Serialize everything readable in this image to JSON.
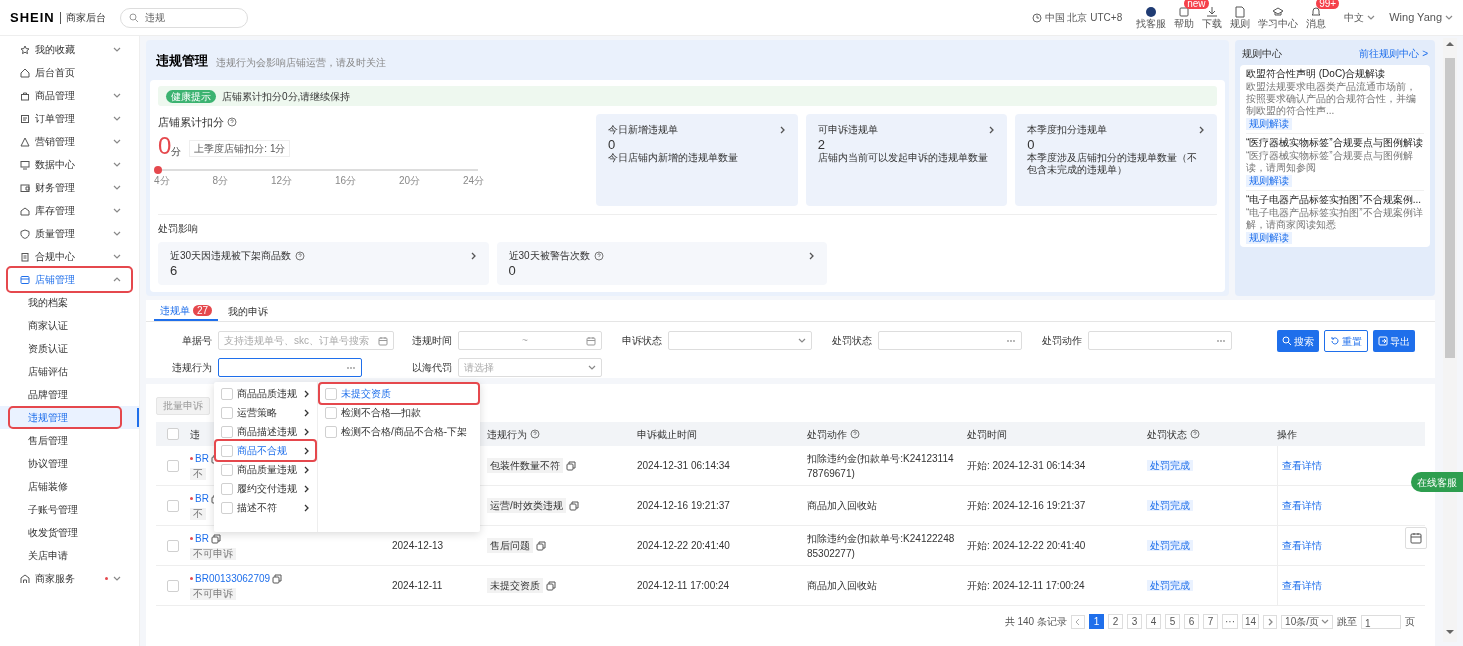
{
  "header": {
    "logo": "SHEIN",
    "subtitle": "商家后台",
    "search_value": "违规",
    "timezone": "中国 北京 UTC+8",
    "tools": [
      {
        "label": "找客服"
      },
      {
        "label": "帮助",
        "badge": "new"
      },
      {
        "label": "下载"
      },
      {
        "label": "规则"
      },
      {
        "label": "学习中心"
      },
      {
        "label": "消息",
        "badge": "99+"
      }
    ],
    "language": "中文",
    "user": "Wing Yang"
  },
  "sidebar": {
    "items": [
      {
        "label": "我的收藏",
        "kind": "group",
        "expanded": false,
        "selected": false,
        "annotated": false,
        "notification": false
      },
      {
        "label": "后台首页",
        "kind": "link",
        "selected": false,
        "annotated": false,
        "notification": false
      },
      {
        "label": "商品管理",
        "kind": "group",
        "expanded": false,
        "selected": false,
        "annotated": false,
        "notification": false
      },
      {
        "label": "订单管理",
        "kind": "group",
        "expanded": false,
        "selected": false,
        "annotated": false,
        "notification": false
      },
      {
        "label": "营销管理",
        "kind": "group",
        "expanded": false,
        "selected": false,
        "annotated": false,
        "notification": false
      },
      {
        "label": "数据中心",
        "kind": "group",
        "expanded": false,
        "selected": false,
        "annotated": false,
        "notification": false
      },
      {
        "label": "财务管理",
        "kind": "group",
        "expanded": false,
        "selected": false,
        "annotated": false,
        "notification": false
      },
      {
        "label": "库存管理",
        "kind": "group",
        "expanded": false,
        "selected": false,
        "annotated": false,
        "notification": false
      },
      {
        "label": "质量管理",
        "kind": "group",
        "expanded": false,
        "selected": false,
        "annotated": false,
        "notification": false
      },
      {
        "label": "合规中心",
        "kind": "group",
        "expanded": false,
        "selected": false,
        "annotated": false,
        "notification": false
      },
      {
        "label": "店铺管理",
        "kind": "group",
        "expanded": true,
        "selected": true,
        "annotated": true,
        "notification": false,
        "children": [
          {
            "label": "我的档案",
            "selected": false,
            "annotated": false
          },
          {
            "label": "商家认证",
            "selected": false,
            "annotated": false
          },
          {
            "label": "资质认证",
            "selected": false,
            "annotated": false
          },
          {
            "label": "店铺评估",
            "selected": false,
            "annotated": false
          },
          {
            "label": "品牌管理",
            "selected": false,
            "annotated": false
          },
          {
            "label": "违规管理",
            "selected": true,
            "annotated": true
          },
          {
            "label": "售后管理",
            "selected": false,
            "annotated": false
          },
          {
            "label": "协议管理",
            "selected": false,
            "annotated": false
          },
          {
            "label": "店铺装修",
            "selected": false,
            "annotated": false
          },
          {
            "label": "子账号管理",
            "selected": false,
            "annotated": false
          },
          {
            "label": "收发货管理",
            "selected": false,
            "annotated": false
          },
          {
            "label": "关店申请",
            "selected": false,
            "annotated": false
          }
        ]
      },
      {
        "label": "商家服务",
        "kind": "group",
        "expanded": false,
        "selected": false,
        "annotated": false,
        "notification": true
      }
    ]
  },
  "page": {
    "title": "违规管理",
    "subtitle": "违规行为会影响店铺运营，请及时关注",
    "notice": {
      "badge": "健康提示",
      "text": "店铺累计扣分0分,请继续保持"
    },
    "score": {
      "label": "店铺累计扣分",
      "value": "0",
      "unit": "分",
      "last_quarter": "上季度店铺扣分: 1分",
      "level": 0,
      "ticks": [
        "4分",
        "8分",
        "12分",
        "16分",
        "20分",
        "24分"
      ]
    },
    "stat_cards": [
      {
        "title": "今日新增违规单",
        "value": "0",
        "desc": "今日店铺内新增的违规单数量"
      },
      {
        "title": "可申诉违规单",
        "value": "2",
        "desc": "店铺内当前可以发起申诉的违规单数量"
      },
      {
        "title": "本季度扣分违规单",
        "value": "0",
        "desc": "本季度涉及店铺扣分的违规单数量（不包含未完成的违规单）"
      }
    ],
    "impact": {
      "title": "处罚影响",
      "cards": [
        {
          "title": "近30天因违规被下架商品数",
          "value": "6"
        },
        {
          "title": "近30天被警告次数",
          "value": "0"
        }
      ]
    }
  },
  "rule_center": {
    "title": "规则中心",
    "link": "前往规则中心 >",
    "articles": [
      {
        "title": "欧盟符合性声明 (DoC)合规解读",
        "desc": "欧盟法规要求电器类产品流通市场前，按照要求确认产品的合规符合性，并编制欧盟的符合性声...",
        "tag": "规则解读"
      },
      {
        "title": "“医疗器械实物标签”合规要点与图例解读",
        "desc": "“医疗器械实物标签”合规要点与图例解读，请周知参阅",
        "tag": "规则解读"
      },
      {
        "title": "“电子电器产品标签实拍图”不合规案例...",
        "desc": "“电子电器产品标签实拍图”不合规案例详解，请商家阅读知悉",
        "tag": "规则解读"
      }
    ]
  },
  "tabs": [
    {
      "label": "违规单",
      "badge": "27",
      "selected": true
    },
    {
      "label": "我的申诉",
      "selected": false
    }
  ],
  "filters": [
    {
      "label": "单据号",
      "kind": "text",
      "placeholder": "支持违规单号、skc、订单号搜索"
    },
    {
      "label": "违规时间",
      "kind": "daterange",
      "separator": "~"
    },
    {
      "label": "申诉状态",
      "kind": "select"
    },
    {
      "label": "处罚状态",
      "kind": "multiselect"
    },
    {
      "label": "处罚动作",
      "kind": "multiselect"
    },
    {
      "label": "违规行为",
      "kind": "cascader",
      "focused": true
    },
    {
      "label": "以海代罚",
      "kind": "select",
      "placeholder": "请选择"
    }
  ],
  "actions": [
    "搜索",
    "重置",
    "导出"
  ],
  "cascader": {
    "level1": [
      {
        "label": "商品品质违规",
        "selected": false,
        "annotated": false,
        "checked": false
      },
      {
        "label": "运营策略",
        "selected": false,
        "annotated": false,
        "checked": false
      },
      {
        "label": "商品描述违规",
        "selected": false,
        "annotated": false,
        "checked": false
      },
      {
        "label": "商品不合规",
        "selected": true,
        "annotated": true,
        "checked": false
      },
      {
        "label": "商品质量违规",
        "selected": false,
        "annotated": false,
        "checked": false
      },
      {
        "label": "履约交付违规",
        "selected": false,
        "annotated": false,
        "checked": false
      },
      {
        "label": "描述不符",
        "selected": false,
        "annotated": false,
        "checked": false
      }
    ],
    "level2": [
      {
        "label": "未提交资质",
        "selected": true,
        "annotated": true,
        "checked": false
      },
      {
        "label": "检测不合格—扣款",
        "selected": false,
        "annotated": false,
        "checked": false
      },
      {
        "label": "检测不合格/商品不合格-下架",
        "selected": false,
        "annotated": false,
        "checked": false
      }
    ]
  },
  "batch_button": {
    "label": "批量申诉",
    "disabled": true
  },
  "table": {
    "all_checked": false,
    "columns": [
      "违",
      "",
      "违规行为",
      "申诉截止时间",
      "处罚动作",
      "处罚时间",
      "处罚状态",
      "操作"
    ],
    "rows": [
      {
        "checked": false,
        "id": "BR",
        "tag": "不",
        "date": "",
        "behavior": "包装件数量不符",
        "deadline": "2024-12-31 06:14:34",
        "action": "扣除违约金(扣款单号:K2412311478769671)",
        "time": "开始: 2024-12-31 06:14:34",
        "status": "处罚完成",
        "op": "查看详情"
      },
      {
        "checked": false,
        "id": "BR",
        "tag": "不",
        "date": "",
        "behavior": "运营/时效类违规",
        "deadline": "2024-12-16 19:21:37",
        "action": "商品加入回收站",
        "time": "开始: 2024-12-16 19:21:37",
        "status": "处罚完成",
        "op": "查看详情"
      },
      {
        "checked": false,
        "id": "BR",
        "tag": "不可申诉",
        "date": "2024-12-13",
        "behavior": "售后问题",
        "deadline": "2024-12-22 20:41:40",
        "action": "扣除违约金(扣款单号:K2412224885302277)",
        "time": "开始: 2024-12-22 20:41:40",
        "status": "处罚完成",
        "op": "查看详情"
      },
      {
        "checked": false,
        "id": "BR00133062709",
        "tag": "不可申诉",
        "date": "2024-12-11",
        "behavior": "未提交资质",
        "deadline": "2024-12-11 17:00:24",
        "action": "商品加入回收站",
        "time": "开始: 2024-12-11 17:00:24",
        "status": "处罚完成",
        "op": "查看详情"
      }
    ]
  },
  "pagination": {
    "total": "共 140 条记录",
    "pages": [
      {
        "label": "1",
        "selected": true
      },
      {
        "label": "2",
        "selected": false
      },
      {
        "label": "3",
        "selected": false
      },
      {
        "label": "4",
        "selected": false
      },
      {
        "label": "5",
        "selected": false
      },
      {
        "label": "6",
        "selected": false
      },
      {
        "label": "7",
        "selected": false
      },
      {
        "label": "···",
        "selected": false
      },
      {
        "label": "14",
        "selected": false
      }
    ],
    "page_size": "10条/页",
    "jump_label": "跳至",
    "jump_value": "1",
    "page_unit": "页"
  },
  "float_button": "在线客服"
}
